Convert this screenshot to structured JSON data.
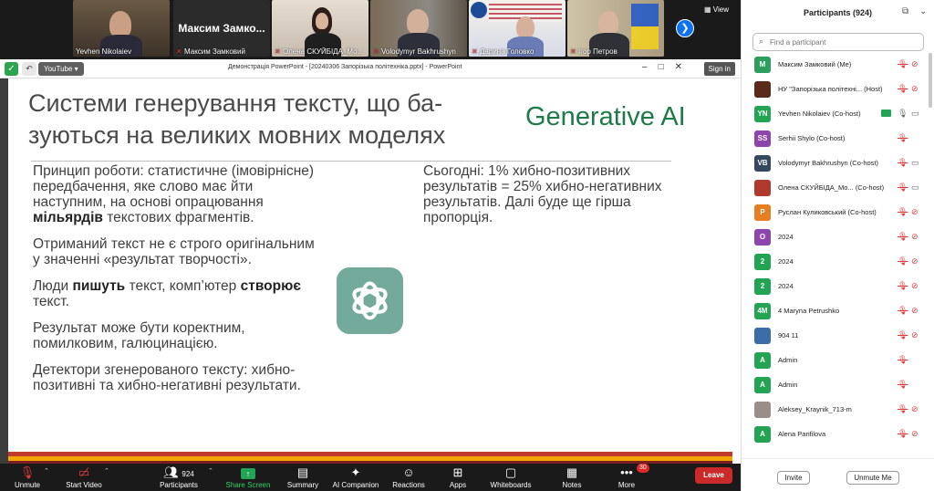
{
  "strip": {
    "tiles": [
      {
        "name": "Yevhen Nikolaiev",
        "muted": false
      },
      {
        "name": "Максим Замковий",
        "big_name": "Максим Замко...",
        "muted": true
      },
      {
        "name": "Олена СКУЙБІДА_Мо...",
        "muted": true
      },
      {
        "name": "Volodymyr Bakhrushyn",
        "muted": true
      },
      {
        "name": "Дарина Головко",
        "muted": true
      },
      {
        "name": "Ігор Петров",
        "muted": true
      }
    ],
    "view_label": "View",
    "next_glyph": "❯"
  },
  "share": {
    "youtube_label": "YouTube",
    "window_title": "Демонстрація PowerPoint - [20240306 Запорізька політехніка.pptx] - PowerPoint",
    "signin_label": "Sign in",
    "slide": {
      "title": "Системи генерування тексту, що ба-зуються на великих мовних моделях",
      "brand": "Generative AI",
      "left": [
        {
          "pre": "Принцип роботи: статистичне (імовірнісне) передбачення, яке слово має йти наступним, на основі опрацювання ",
          "bold": "мільярдів",
          "post": " текстових фрагментів."
        },
        {
          "pre": "Отриманий текст не є строго оригінальним у значенні «результат творчості».",
          "bold": "",
          "post": ""
        },
        {
          "pre": "Люди ",
          "bold": "пишуть",
          "post": " текст, комп’ютер ",
          "bold2": "створює",
          "post2": " текст."
        },
        {
          "pre": "Результат може бути коректним, помилковим, галюцинацією.",
          "bold": "",
          "post": ""
        },
        {
          "pre": "Детектори згенерованого тексту: хибно-позитивні та хибно-негативні результати.",
          "bold": "",
          "post": ""
        }
      ],
      "right": "Сьогодні: 1% хибно-позитивних результатів = 25% хибно-негативних результатів. Далі буде ще гірша пропорція."
    }
  },
  "toolbar": {
    "unmute": "Unmute",
    "start_video": "Start Video",
    "participants": "Participants",
    "participants_count": "924",
    "share_screen": "Share Screen",
    "summary": "Summary",
    "ai_companion": "AI Companion",
    "reactions": "Reactions",
    "apps": "Apps",
    "whiteboards": "Whiteboards",
    "notes": "Notes",
    "more": "More",
    "more_badge": "30",
    "leave": "Leave"
  },
  "panel": {
    "title": "Participants (924)",
    "search_placeholder": "Find a participant",
    "participants": [
      {
        "initials": "M",
        "color": "#2e9e5e",
        "name": "Максим Замковий (Me)",
        "mic": "muted",
        "cam": "off"
      },
      {
        "initials": "",
        "color": "#5a2a1a",
        "name": "НУ \"Запорізька політехні... (Host)",
        "mic": "muted",
        "cam": "off"
      },
      {
        "initials": "YN",
        "color": "#23a455",
        "name": "Yevhen Nikolaiev (Co-host)",
        "mic": "on",
        "cam": "on",
        "sharing": true
      },
      {
        "initials": "SS",
        "color": "#8e44ad",
        "name": "Serhii Shylo (Co-host)",
        "mic": "muted",
        "cam": "none"
      },
      {
        "initials": "VB",
        "color": "#34495e",
        "name": "Volodymyr Bakhrushyn (Co-host)",
        "mic": "muted",
        "cam": "on"
      },
      {
        "initials": "",
        "color": "#b03a2e",
        "name": "Олена СКУЙБІДА_Мо... (Co-host)",
        "mic": "muted",
        "cam": "on"
      },
      {
        "initials": "P",
        "color": "#e67e22",
        "name": "Руслан Куликовський (Co-host)",
        "mic": "muted",
        "cam": "off"
      },
      {
        "initials": "O",
        "color": "#8e44ad",
        "name": "2024",
        "mic": "muted",
        "cam": "off"
      },
      {
        "initials": "2",
        "color": "#23a455",
        "name": "2024",
        "mic": "muted",
        "cam": "off"
      },
      {
        "initials": "2",
        "color": "#23a455",
        "name": "2024",
        "mic": "muted",
        "cam": "off"
      },
      {
        "initials": "4M",
        "color": "#23a455",
        "name": "4 Maryna Petrushko",
        "mic": "muted",
        "cam": "off"
      },
      {
        "initials": "",
        "color": "#3b6ea8",
        "name": "904 11",
        "mic": "muted",
        "cam": "off"
      },
      {
        "initials": "A",
        "color": "#23a455",
        "name": "Admin",
        "mic": "muted",
        "cam": "none"
      },
      {
        "initials": "A",
        "color": "#23a455",
        "name": "Admin",
        "mic": "muted",
        "cam": "none"
      },
      {
        "initials": "",
        "color": "#9a8f88",
        "name": "Aleksey_Kraynik_713-m",
        "mic": "muted",
        "cam": "off"
      },
      {
        "initials": "A",
        "color": "#23a455",
        "name": "Alena Panfilova",
        "mic": "muted",
        "cam": "off"
      }
    ],
    "invite_label": "Invite",
    "unmute_me_label": "Unmute Me"
  },
  "colors": {
    "brand_green": "#1e7a47",
    "leave_red": "#cb2a2a",
    "muted_red": "#e0393e",
    "share_green": "#23a455"
  }
}
